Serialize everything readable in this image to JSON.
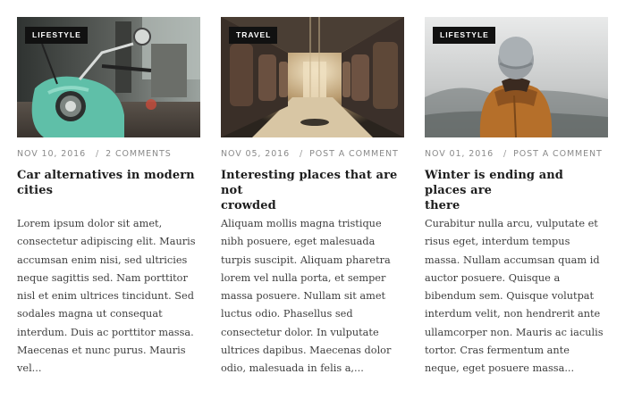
{
  "posts": [
    {
      "category": "LIFESTYLE",
      "date": "NOV 10, 2016",
      "comments": "2 COMMENTS",
      "title_lines": [
        "Car alternatives in modern",
        "cities"
      ],
      "excerpt_lines": [
        "Lorem ipsum dolor sit amet,",
        "consectetur adipiscing elit. Mauris",
        "accumsan enim nisi, sed ultricies",
        "neque sagittis sed. Nam porttitor",
        "nisl et enim ultrices tincidunt. Sed",
        "sodales magna ut consequat",
        "interdum. Duis ac porttitor massa.",
        "Maecenas et nunc purus. Mauris",
        "vel..."
      ]
    },
    {
      "category": "TRAVEL",
      "date": "NOV 05, 2016",
      "comments": "POST A COMMENT",
      "title_lines": [
        "Interesting places that are not",
        "crowded"
      ],
      "excerpt_lines": [
        "Aliquam mollis magna tristique",
        "nibh posuere, eget malesuada",
        "turpis suscipit. Aliquam pharetra",
        "lorem vel nulla porta, et semper",
        "massa posuere. Nullam sit amet",
        "luctus odio. Phasellus sed",
        "consectetur dolor. In vulputate",
        "ultrices dapibus. Maecenas dolor",
        "odio, malesuada in felis a,..."
      ]
    },
    {
      "category": "LIFESTYLE",
      "date": "NOV 01, 2016",
      "comments": "POST A COMMENT",
      "title_lines": [
        "Winter is ending and places are",
        "there"
      ],
      "excerpt_lines": [
        "Curabitur nulla arcu, vulputate et",
        "risus eget, interdum tempus",
        "massa. Nullam accumsan quam id",
        "auctor posuere. Quisque a",
        "bibendum sem. Quisque volutpat",
        "interdum velit, non hendrerit ante",
        "ullamcorper non. Mauris ac iaculis",
        "tortor. Cras fermentum ante",
        "neque, eget posuere massa..."
      ]
    }
  ],
  "separator": "/"
}
